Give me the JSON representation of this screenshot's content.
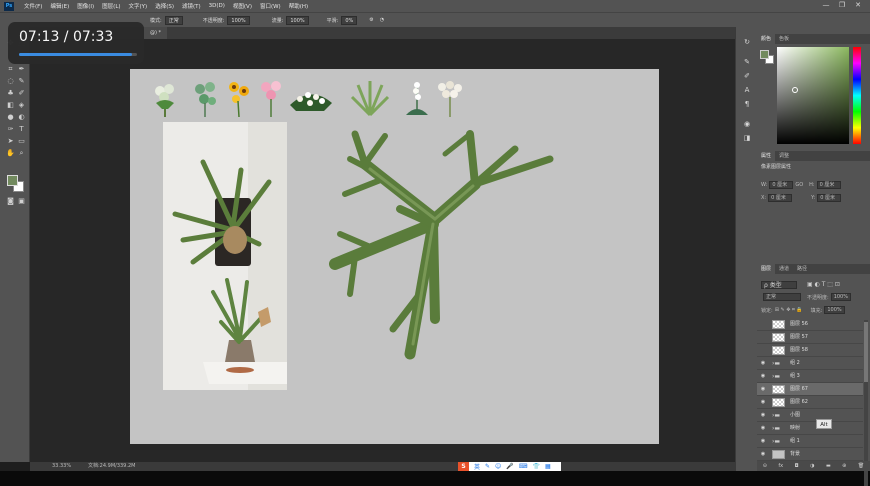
{
  "menubar": {
    "logo": "Ps",
    "items": [
      "文件(F)",
      "编辑(E)",
      "图像(I)",
      "图层(L)",
      "文字(Y)",
      "选择(S)",
      "滤镜(T)",
      "3D(D)",
      "视图(V)",
      "窗口(W)",
      "帮助(H)"
    ],
    "window_buttons": [
      "—",
      "❐",
      "✕"
    ]
  },
  "options": {
    "mode_label": "模式:",
    "mode_value": "正常",
    "opacity_label": "不透明度:",
    "opacity_value": "100%",
    "flow_label": "流量:",
    "flow_value": "100%",
    "smooth_label": "平滑:",
    "smooth_value": "0%"
  },
  "video": {
    "time": "07:13 / 07:33",
    "progress": 0.956,
    "accent": "#3b8fe6"
  },
  "document": {
    "tab_title": "@) *"
  },
  "status": {
    "zoom": "33.33%",
    "doc": "文档:24.9M/339.2M"
  },
  "colors": {
    "foreground": "#728a5e",
    "background": "#ffffff",
    "plant": "#5c7d3d",
    "canvas": "#c4c4c4"
  },
  "color_panel": {
    "tabs": [
      "颜色",
      "色板"
    ]
  },
  "properties": {
    "tabs": [
      "属性",
      "调整"
    ],
    "title": "像素图层属性",
    "w_label": "W:",
    "w_value": "0 厘米",
    "h_label": "H:",
    "h_value": "0 厘米",
    "x_label": "X:",
    "x_value": "0 厘米",
    "y_label": "Y:",
    "y_value": "0 厘米",
    "link": "GO"
  },
  "layers": {
    "tabs": [
      "图层",
      "通道",
      "路径"
    ],
    "filter": "ρ 类型",
    "blend": "正常",
    "opacity_label": "不透明度:",
    "opacity_value": "100%",
    "lock_label": "锁定:",
    "fill_label": "填充:",
    "fill_value": "100%",
    "items": [
      {
        "name": "图层 56",
        "type": "layer",
        "visible": false
      },
      {
        "name": "图层 57",
        "type": "layer",
        "visible": false
      },
      {
        "name": "图层 58",
        "type": "layer",
        "visible": false
      },
      {
        "name": "组 2",
        "type": "group",
        "visible": true
      },
      {
        "name": "组 3",
        "type": "group",
        "visible": true
      },
      {
        "name": "图层 67",
        "type": "layer",
        "visible": true,
        "selected": true
      },
      {
        "name": "图层 62",
        "type": "layer",
        "visible": true
      },
      {
        "name": "小图",
        "type": "group",
        "visible": true
      },
      {
        "name": "映射",
        "type": "group",
        "visible": true
      },
      {
        "name": "组 1",
        "type": "group",
        "visible": true
      },
      {
        "name": "背景",
        "type": "background",
        "visible": true
      }
    ],
    "tooltip": "Alt",
    "footer_icons": [
      "link-icon",
      "fx-icon",
      "mask-icon",
      "adjustment-icon",
      "folder-icon",
      "new-layer-icon",
      "trash-icon"
    ],
    "footer_labels": [
      "⊝",
      "fx",
      "◘",
      "◑",
      "▬",
      "⊕",
      "🗑"
    ]
  },
  "ime": {
    "logo": "S",
    "icons": [
      "英",
      "✎",
      "☺",
      "🎤",
      "⌨",
      "👕",
      "▦"
    ]
  }
}
